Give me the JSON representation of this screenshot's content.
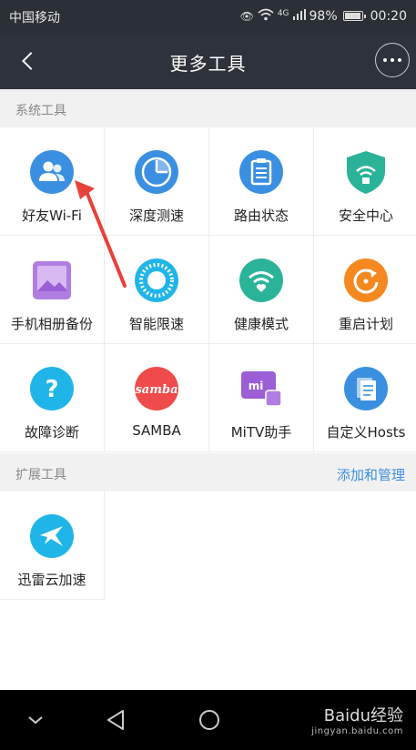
{
  "status_bar": {
    "carrier": "中国移动",
    "network": "4G",
    "battery": "98%",
    "time": "00:20"
  },
  "header": {
    "title": "更多工具"
  },
  "sections": {
    "system": {
      "title": "系统工具",
      "items": [
        {
          "label": "好友Wi-Fi",
          "icon": "friends-wifi-icon",
          "color": "#3b8fe0"
        },
        {
          "label": "深度测速",
          "icon": "speed-test-icon",
          "color": "#3b8fe0"
        },
        {
          "label": "路由状态",
          "icon": "router-status-icon",
          "color": "#3b8fe0"
        },
        {
          "label": "安全中心",
          "icon": "security-shield-icon",
          "color": "#2bb39a"
        },
        {
          "label": "手机相册备份",
          "icon": "photo-backup-icon",
          "color": "#9b5ed6"
        },
        {
          "label": "智能限速",
          "icon": "smart-speed-limit-icon",
          "color": "#1fb5e8"
        },
        {
          "label": "健康模式",
          "icon": "health-mode-icon",
          "color": "#2bb39a"
        },
        {
          "label": "重启计划",
          "icon": "reboot-plan-icon",
          "color": "#f5891f"
        },
        {
          "label": "故障诊断",
          "icon": "diagnose-icon",
          "color": "#1fb5e8"
        },
        {
          "label": "SAMBA",
          "icon": "samba-icon",
          "color": "#ef4b4b"
        },
        {
          "label": "MiTV助手",
          "icon": "mitv-icon",
          "color": "#9b5ed6"
        },
        {
          "label": "自定义Hosts",
          "icon": "hosts-icon",
          "color": "#3b8fe0"
        }
      ]
    },
    "extended": {
      "title": "扩展工具",
      "action": "添加和管理",
      "items": [
        {
          "label": "迅雷云加速",
          "icon": "xunlei-icon",
          "color": "#1fb5e8"
        }
      ]
    }
  },
  "watermark": {
    "brand": "Baidu经验",
    "url": "jingyan.baidu.com"
  }
}
